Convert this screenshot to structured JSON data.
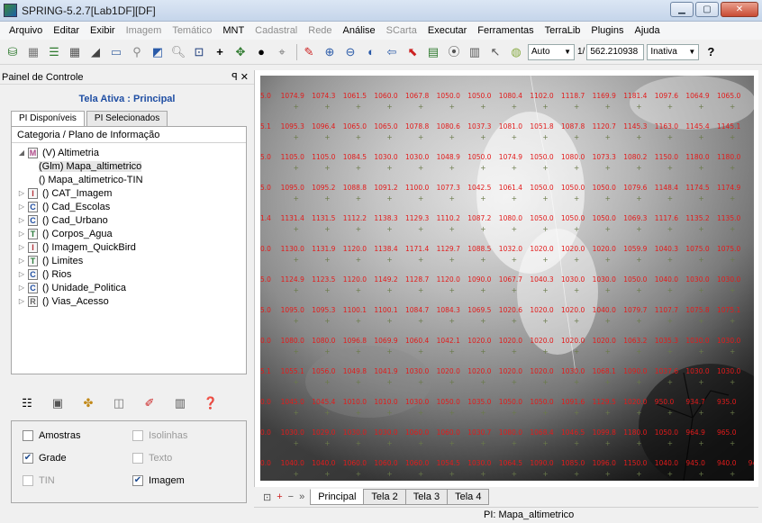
{
  "window": {
    "title": "SPRING-5.2.7[Lab1DF][DF]"
  },
  "menu": [
    {
      "label": "Arquivo",
      "enabled": true
    },
    {
      "label": "Editar",
      "enabled": true
    },
    {
      "label": "Exibir",
      "enabled": true
    },
    {
      "label": "Imagem",
      "enabled": false
    },
    {
      "label": "Temático",
      "enabled": false
    },
    {
      "label": "MNT",
      "enabled": true
    },
    {
      "label": "Cadastral",
      "enabled": false
    },
    {
      "label": "Rede",
      "enabled": false
    },
    {
      "label": "Análise",
      "enabled": true
    },
    {
      "label": "SCarta",
      "enabled": false
    },
    {
      "label": "Executar",
      "enabled": true
    },
    {
      "label": "Ferramentas",
      "enabled": true
    },
    {
      "label": "TerraLib",
      "enabled": true
    },
    {
      "label": "Plugins",
      "enabled": true
    },
    {
      "label": "Ajuda",
      "enabled": true
    }
  ],
  "toolbar": {
    "zoom_mode": "Auto",
    "scale_prefix": "1/",
    "scale_value": "562.210938",
    "state": "Inativa"
  },
  "panel": {
    "title": "Painel de Controle",
    "active_screen": "Tela Ativa : Principal",
    "tabs": [
      "PI Disponíveis",
      "PI Selecionados"
    ],
    "tree_header": "Categoria / Plano de Informação",
    "tree": [
      {
        "cat": "M",
        "label": "(V) Altimetria",
        "expanded": true,
        "indent": 0
      },
      {
        "cat": "",
        "label": "(Glm) Mapa_altimetrico",
        "indent": 1,
        "selected": true
      },
      {
        "cat": "",
        "label": "() Mapa_altimetrico-TIN",
        "indent": 1
      },
      {
        "cat": "I",
        "label": "() CAT_Imagem",
        "indent": 0
      },
      {
        "cat": "C",
        "label": "() Cad_Escolas",
        "indent": 0
      },
      {
        "cat": "C",
        "label": "() Cad_Urbano",
        "indent": 0
      },
      {
        "cat": "T",
        "label": "() Corpos_Agua",
        "indent": 0
      },
      {
        "cat": "I",
        "label": "() Imagem_QuickBird",
        "indent": 0
      },
      {
        "cat": "T",
        "label": "() Limites",
        "indent": 0
      },
      {
        "cat": "C",
        "label": "() Rios",
        "indent": 0
      },
      {
        "cat": "C",
        "label": "() Unidade_Politica",
        "indent": 0
      },
      {
        "cat": "R",
        "label": "() Vias_Acesso",
        "indent": 0
      }
    ],
    "checks": [
      {
        "label": "Amostras",
        "checked": false,
        "enabled": true
      },
      {
        "label": "Isolinhas",
        "checked": false,
        "enabled": false
      },
      {
        "label": "Grade",
        "checked": true,
        "enabled": true
      },
      {
        "label": "Texto",
        "checked": false,
        "enabled": false
      },
      {
        "label": "TIN",
        "checked": false,
        "enabled": false
      },
      {
        "label": "Imagem",
        "checked": true,
        "enabled": true
      }
    ]
  },
  "map": {
    "grid_rows": [
      [
        "5.0",
        "1074.9",
        "1074.3",
        "1061.5",
        "1060.0",
        "1067.8",
        "1050.0",
        "1050.0",
        "1080.4",
        "1102.0",
        "1118.7",
        "1169.9",
        "1181.4",
        "1097.6",
        "1064.9",
        "1065.0"
      ],
      [
        "5.1",
        "1095.3",
        "1096.4",
        "1065.0",
        "1065.0",
        "1078.8",
        "1080.6",
        "1037.3",
        "1081.0",
        "1051.8",
        "1087.8",
        "1120.7",
        "1145.3",
        "1163.0",
        "1145.4",
        "1145.1"
      ],
      [
        "5.0",
        "1105.0",
        "1105.0",
        "1084.5",
        "1030.0",
        "1030.0",
        "1048.9",
        "1050.0",
        "1074.9",
        "1050.0",
        "1080.0",
        "1073.3",
        "1080.2",
        "1150.0",
        "1180.0",
        "1180.0"
      ],
      [
        "5.0",
        "1095.0",
        "1095.2",
        "1088.8",
        "1091.2",
        "1100.0",
        "1077.3",
        "1042.5",
        "1061.4",
        "1050.0",
        "1050.0",
        "1050.0",
        "1079.6",
        "1148.4",
        "1174.5",
        "1174.9"
      ],
      [
        "1.4",
        "1131.4",
        "1131.5",
        "1112.2",
        "1138.3",
        "1129.3",
        "1110.2",
        "1087.2",
        "1080.0",
        "1050.0",
        "1050.0",
        "1050.0",
        "1069.3",
        "1117.6",
        "1135.2",
        "1135.0"
      ],
      [
        "0.0",
        "1130.0",
        "1131.9",
        "1120.0",
        "1138.4",
        "1171.4",
        "1129.7",
        "1088.5",
        "1032.0",
        "1020.0",
        "1020.0",
        "1020.0",
        "1059.9",
        "1040.3",
        "1075.0",
        "1075.0"
      ],
      [
        "5.0",
        "1124.9",
        "1123.5",
        "1120.0",
        "1149.2",
        "1128.7",
        "1120.0",
        "1090.0",
        "1067.7",
        "1040.3",
        "1030.0",
        "1030.0",
        "1050.0",
        "1040.0",
        "1030.0",
        "1030.0"
      ],
      [
        "5.0",
        "1095.0",
        "1095.3",
        "1100.1",
        "1100.1",
        "1084.7",
        "1084.3",
        "1069.5",
        "1020.6",
        "1020.0",
        "1020.0",
        "1040.0",
        "1079.7",
        "1107.7",
        "1075.8",
        "1075.1"
      ],
      [
        "0.0",
        "1080.0",
        "1080.0",
        "1096.8",
        "1069.9",
        "1060.4",
        "1042.1",
        "1020.0",
        "1020.0",
        "1020.0",
        "1020.0",
        "1020.0",
        "1063.2",
        "1035.3",
        "1030.0",
        "1030.0"
      ],
      [
        "5.1",
        "1055.1",
        "1056.0",
        "1049.8",
        "1041.9",
        "1030.0",
        "1020.0",
        "1020.0",
        "1020.0",
        "1020.0",
        "1030.0",
        "1068.1",
        "1090.0",
        "1037.6",
        "1030.0",
        "1030.0"
      ],
      [
        "0.0",
        "1045.0",
        "1045.4",
        "1010.0",
        "1010.0",
        "1030.0",
        "1050.0",
        "1035.0",
        "1050.0",
        "1050.0",
        "1091.6",
        "1129.5",
        "1020.0",
        "950.0",
        "934.7",
        "935.0"
      ],
      [
        "0.0",
        "1030.0",
        "1029.0",
        "1030.0",
        "1030.0",
        "1060.0",
        "1060.0",
        "1030.7",
        "1080.0",
        "1068.4",
        "1046.5",
        "1099.8",
        "1180.0",
        "1050.0",
        "964.9",
        "965.0"
      ],
      [
        "0.0",
        "1040.0",
        "1040.0",
        "1060.0",
        "1060.0",
        "1060.0",
        "1054.5",
        "1030.0",
        "1064.5",
        "1090.0",
        "1085.0",
        "1096.0",
        "1150.0",
        "1040.0",
        "945.0",
        "940.0",
        "940.0"
      ]
    ]
  },
  "bottom_tabs": [
    "Principal",
    "Tela 2",
    "Tela 3",
    "Tela 4"
  ],
  "status": {
    "text": "PI: Mapa_altimetrico"
  }
}
